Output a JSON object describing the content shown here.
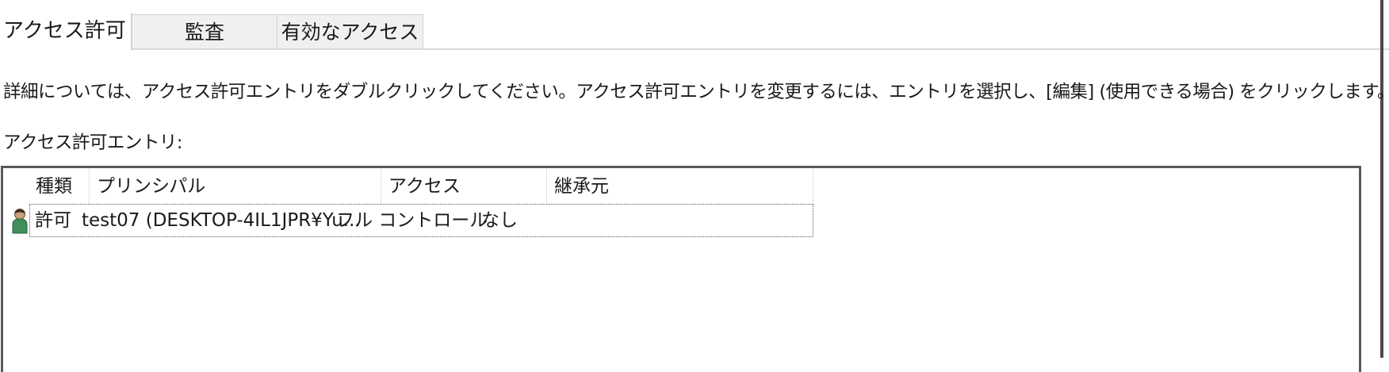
{
  "tabs": [
    {
      "label": "アクセス許可",
      "active": true
    },
    {
      "label": "監査",
      "active": false
    },
    {
      "label": "有効なアクセス",
      "active": false
    }
  ],
  "description": "詳細については、アクセス許可エントリをダブルクリックしてください。アクセス許可エントリを変更するには、エントリを選択し、[編集] (使用できる場合) をクリックします。",
  "entries_label": "アクセス許可エントリ:",
  "columns": {
    "type": "種類",
    "principal": "プリンシパル",
    "access": "アクセス",
    "inherited_from": "継承元"
  },
  "rows": [
    {
      "icon": "user-icon",
      "type": "許可",
      "principal": "test07 (DESKTOP-4IL1JPR¥Yu...",
      "access": "フル コントロール",
      "inherited_from": "なし",
      "selected": true
    }
  ],
  "colors": {
    "tab_inactive_bg": "#f0f0f0",
    "border_dark": "#5a5a5a",
    "icon_green": "#3f8f5a"
  }
}
